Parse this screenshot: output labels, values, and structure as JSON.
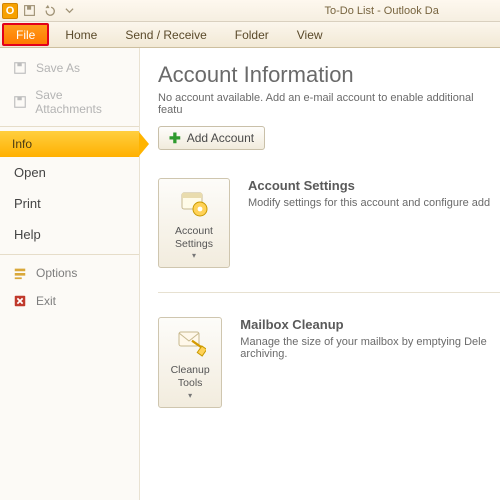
{
  "window": {
    "title": "To-Do List - Outlook Da"
  },
  "ribbon": {
    "file": "File",
    "tabs": [
      "Home",
      "Send / Receive",
      "Folder",
      "View"
    ]
  },
  "nav": {
    "save_as": "Save As",
    "save_attachments": "Save Attachments",
    "info": "Info",
    "open": "Open",
    "print": "Print",
    "help": "Help",
    "options": "Options",
    "exit": "Exit"
  },
  "content": {
    "heading": "Account Information",
    "no_account": "No account available. Add an e-mail account to enable additional featu",
    "add_account": "Add Account",
    "account_settings": {
      "btn": "Account Settings",
      "title": "Account Settings",
      "desc": "Modify settings for this account and configure add"
    },
    "cleanup": {
      "btn": "Cleanup Tools",
      "title": "Mailbox Cleanup",
      "desc": "Manage the size of your mailbox by emptying Dele archiving."
    }
  }
}
